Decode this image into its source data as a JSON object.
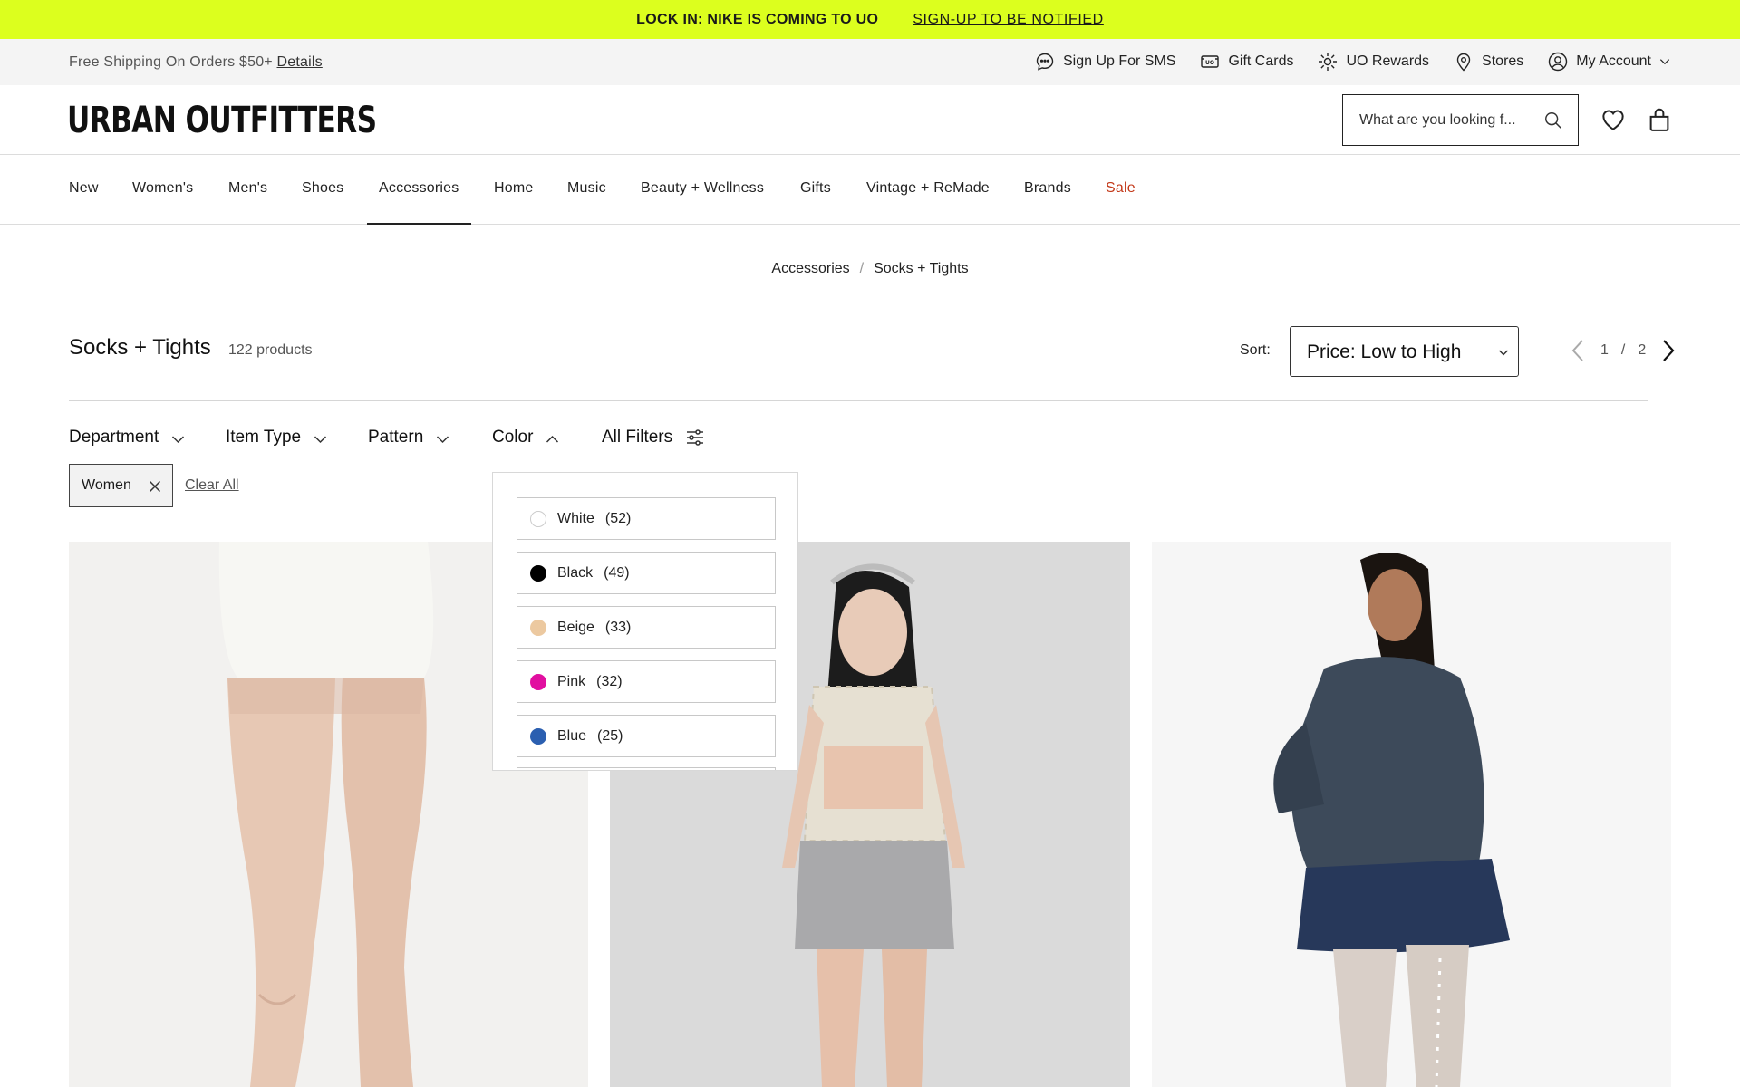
{
  "promo": {
    "headline": "LOCK IN: NIKE IS COMING TO UO",
    "link": "SIGN-UP TO BE NOTIFIED"
  },
  "utility": {
    "shipping_text": "Free Shipping On Orders $50+",
    "details_link": "Details",
    "links": [
      {
        "label": "Sign Up For SMS",
        "icon": "chat-bubble-icon"
      },
      {
        "label": "Gift Cards",
        "icon": "gift-card-icon"
      },
      {
        "label": "UO Rewards",
        "icon": "sparkle-icon"
      },
      {
        "label": "Stores",
        "icon": "map-pin-icon"
      },
      {
        "label": "My Account",
        "icon": "user-icon"
      }
    ]
  },
  "header": {
    "logo": "URBAN OUTFITTERS",
    "search_placeholder": "What are you looking f..."
  },
  "nav": {
    "items": [
      "New",
      "Women's",
      "Men's",
      "Shoes",
      "Accessories",
      "Home",
      "Music",
      "Beauty + Wellness",
      "Gifts",
      "Vintage + ReMade",
      "Brands",
      "Sale"
    ],
    "active": "Accessories"
  },
  "breadcrumb": {
    "parent": "Accessories",
    "separator": "/",
    "current": "Socks + Tights"
  },
  "listing": {
    "title": "Socks + Tights",
    "count": "122 products",
    "sort_label": "Sort:",
    "sort_value": "Price: Low to High",
    "page_current": "1",
    "page_separator": "/",
    "page_total": "2"
  },
  "filters": {
    "department": "Department",
    "item_type": "Item Type",
    "pattern": "Pattern",
    "color": "Color",
    "all_filters": "All Filters"
  },
  "active_filter": {
    "label": "Women",
    "clear_all": "Clear All"
  },
  "color_options": [
    {
      "label": "White",
      "count": "(52)",
      "hex": "#ffffff"
    },
    {
      "label": "Black",
      "count": "(49)",
      "hex": "#000000"
    },
    {
      "label": "Beige",
      "count": "(33)",
      "hex": "#ecc9a0"
    },
    {
      "label": "Pink",
      "count": "(32)",
      "hex": "#e10fa0"
    },
    {
      "label": "Blue",
      "count": "(25)",
      "hex": "#2b5fb0"
    }
  ],
  "colors": {
    "promo_bg": "#dcff1e",
    "sale_red": "#c23616",
    "utility_bg": "#f4f4f4"
  }
}
